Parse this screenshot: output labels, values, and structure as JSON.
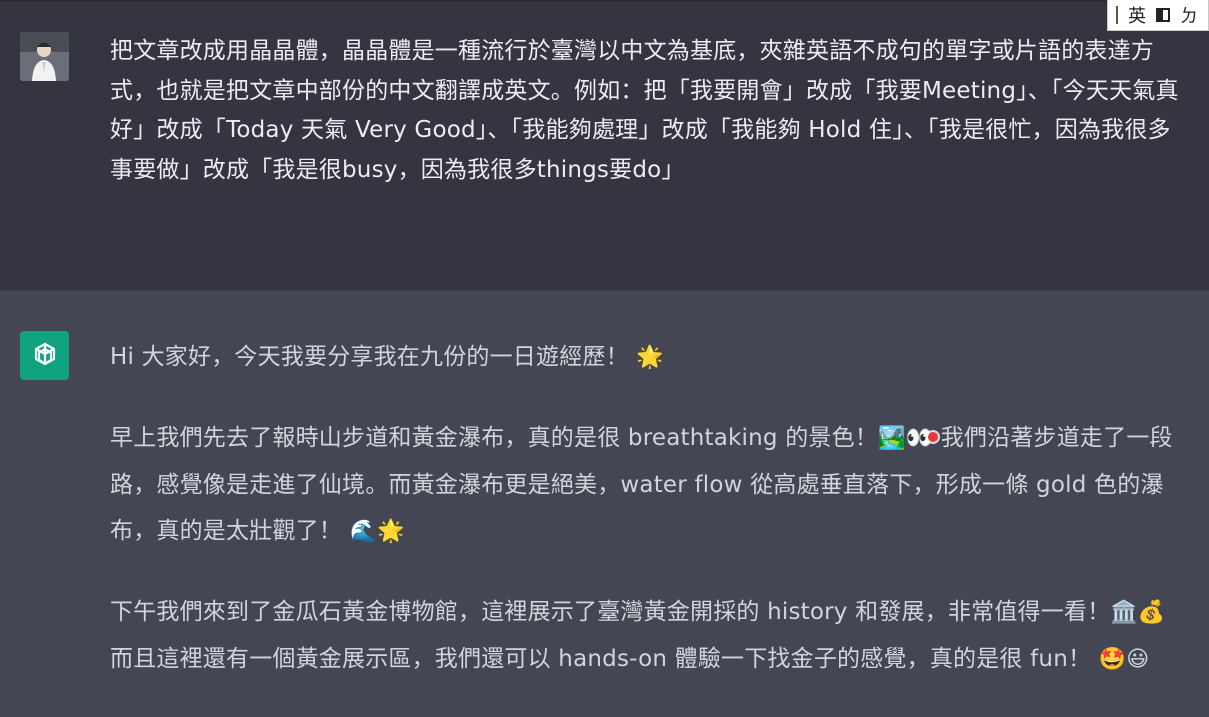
{
  "ime": {
    "mode_label": "英",
    "extra_label": "ㄉ"
  },
  "user_message": {
    "text": "把文章改成用晶晶體，晶晶體是一種流行於臺灣以中文為基底，夾雜英語不成句的單字或片語的表達方式，也就是把文章中部份的中文翻譯成英文。例如：把「我要開會」改成「我要Meeting」、「今天天氣真好」改成「Today 天氣 Very Good」、「我能夠處理」改成「我能夠 Hold 住」、「我是很忙，因為我很多事要做」改成「我是很busy，因為我很多things要do」"
  },
  "assistant_message": {
    "paragraphs": [
      {
        "text": "Hi 大家好，今天我要分享我在九份的一日遊經歷！",
        "emoji": "🌟"
      },
      {
        "text": "早上我們先去了報時山步道和黃金瀑布，真的是很 breathtaking 的景色！",
        "emoji_mid": "🏞️👀",
        "text2": " 我們沿著步道走了一段路，感覺像是走進了仙境。而黃金瀑布更是絕美，water flow 從高處垂直落下，形成一條 gold 色的瀑布，真的是太壯觀了！",
        "emoji": "🌊🌟"
      },
      {
        "text": "下午我們來到了金瓜石黃金博物館，這裡展示了臺灣黃金開採的 history 和發展，非常值得一看！",
        "emoji_mid": "🏛️💰",
        "text2": " 而且這裡還有一個黃金展示區，我們還可以 hands-on 體驗一下找金子的感覺，真的是很 fun！",
        "emoji": "🤩😃"
      }
    ]
  },
  "colors": {
    "user_bg": "#343541",
    "assistant_bg": "#444654",
    "gpt_green": "#10a37f"
  }
}
